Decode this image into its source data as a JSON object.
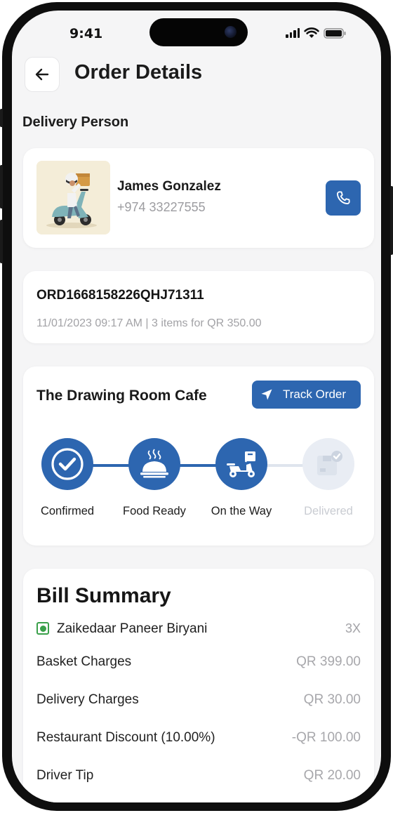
{
  "status_bar": {
    "time": "9:41"
  },
  "header": {
    "title": "Order Details",
    "back_icon": "arrow-left-icon"
  },
  "delivery_person": {
    "section_title": "Delivery Person",
    "name": "James Gonzalez",
    "phone": "+974 33227555",
    "call_icon": "phone-icon"
  },
  "order": {
    "id": "ORD1668158226QHJ71311",
    "meta": "11/01/2023 09:17 AM | 3 items for QR 350.00"
  },
  "tracking": {
    "restaurant": "The Drawing Room Cafe",
    "track_button": "Track Order",
    "steps": [
      {
        "label": "Confirmed",
        "icon": "check-icon",
        "done": true
      },
      {
        "label": "Food Ready",
        "icon": "food-cloche-icon",
        "done": true
      },
      {
        "label": "On the Way",
        "icon": "delivery-scooter-icon",
        "done": true
      },
      {
        "label": "Delivered",
        "icon": "package-check-icon",
        "done": false
      }
    ]
  },
  "bill": {
    "title": "Bill Summary",
    "item": {
      "name": "Zaikedaar Paneer Biryani",
      "qty": "3X"
    },
    "rows": [
      {
        "label": "Basket Charges",
        "value": "QR 399.00"
      },
      {
        "label": "Delivery Charges",
        "value": "QR 30.00"
      },
      {
        "label": "Restaurant Discount (10.00%)",
        "value": "-QR 100.00"
      },
      {
        "label": "Driver Tip",
        "value": "QR 20.00"
      }
    ]
  },
  "colors": {
    "accent": "#2d66b0",
    "background": "#f5f5f6",
    "veg": "#3aa04a",
    "muted": "#a3a3a7"
  }
}
